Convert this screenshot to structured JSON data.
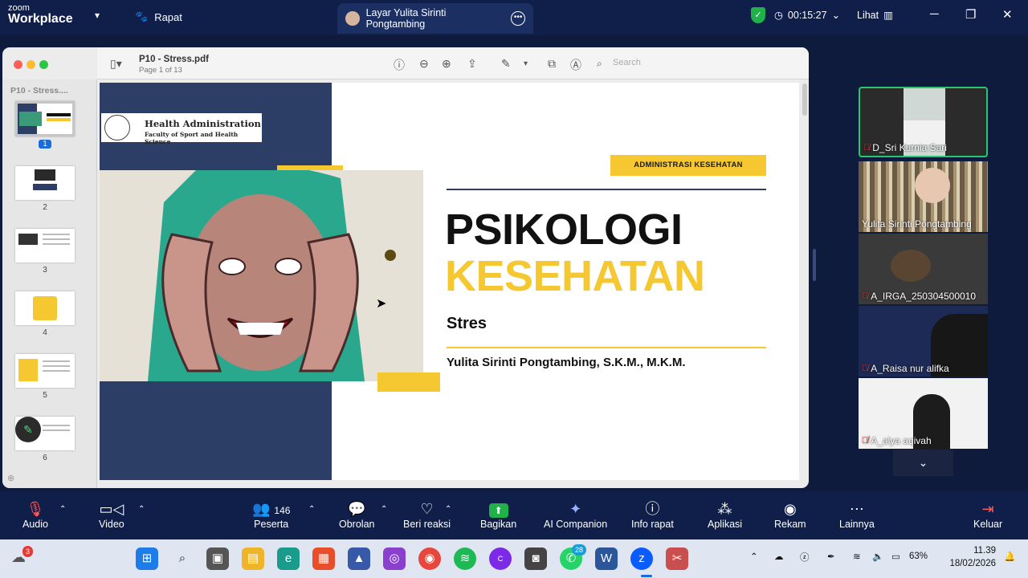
{
  "zoom": {
    "logo_top": "zoom",
    "logo_bottom": "Workplace",
    "meeting_label": "Rapat",
    "share_tab_label": "Layar Yulita Sirinti Pongtambing",
    "timer": "00:15:27",
    "view_label": "Lihat"
  },
  "pdf": {
    "filename": "P10 - Stress.pdf",
    "page_info": "Page 1 of 13",
    "search_placeholder": "Search",
    "sidebar_title": "P10 - Stress....",
    "thumbnails": [
      "1",
      "2",
      "3",
      "4",
      "5",
      "6"
    ]
  },
  "slide": {
    "logo_title": "Health Administration",
    "logo_subtitle": "Faculty of Sport and Health Science",
    "tag": "ADMINISTRASI KESEHATAN",
    "title_line1": "PSIKOLOGI",
    "title_line2": "KESEHATAN",
    "subtitle": "Stres",
    "author": "Yulita Sirinti Pongtambing, S.K.M., M.K.M."
  },
  "participants": [
    {
      "name": "D_Sri Kurnia Sari",
      "muted": true,
      "active": true
    },
    {
      "name": "Yulita Sirinti Pongtambing",
      "muted": false,
      "active": false
    },
    {
      "name": "A_IRGA_250304500010",
      "muted": true,
      "active": false
    },
    {
      "name": "A_Raisa nur alifka",
      "muted": true,
      "active": false
    },
    {
      "name": "A_alya aqivah",
      "muted": true,
      "active": false
    }
  ],
  "controls": {
    "audio": "Audio",
    "video": "Video",
    "participants": "Peserta",
    "participants_count": "146",
    "chat": "Obrolan",
    "react": "Beri reaksi",
    "share": "Bagikan",
    "ai": "AI Companion",
    "info": "Info rapat",
    "apps": "Aplikasi",
    "record": "Rekam",
    "more": "Lainnya",
    "leave": "Keluar"
  },
  "taskbar": {
    "weather_badge": "3",
    "whatsapp_badge": "28",
    "battery": "63%",
    "time": "11.39",
    "date": "18/02/2026"
  },
  "colors": {
    "zoom_navy": "#0f1f4a",
    "slide_navy": "#2c3e66",
    "slide_yellow": "#f5c730",
    "active_green": "#28c76f"
  }
}
